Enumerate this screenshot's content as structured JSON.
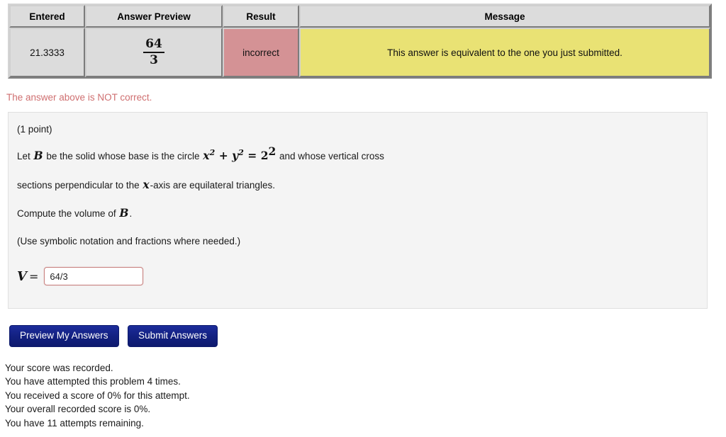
{
  "results_table": {
    "headers": [
      "Entered",
      "Answer Preview",
      "Result",
      "Message"
    ],
    "row": {
      "entered": "21.3333",
      "preview_numerator": "64",
      "preview_denominator": "3",
      "result": "incorrect",
      "message": "This answer is equivalent to the one you just submitted."
    },
    "colors": {
      "header_bg": "#dcdcdc",
      "cell_bg": "#dcdcdc",
      "result_bg": "#d49295",
      "result_text": "#241d8c",
      "message_bg": "#e9e274"
    }
  },
  "notice": {
    "text": "The answer above is NOT correct.",
    "color": "#cf6f70"
  },
  "problem": {
    "points": "(1 point)",
    "line1_a": "Let ",
    "line1_var": "B",
    "line1_b": " be the solid whose base is the circle ",
    "line1_math": {
      "x": "x",
      "x_exp": "2",
      "plus": "+",
      "y": "y",
      "y_exp": "2",
      "equals": "=",
      "two": "2",
      "two_exp": "2"
    },
    "line1_c": " and whose vertical cross",
    "line2_a": "sections perpendicular to the ",
    "line2_var": "x",
    "line2_b": "-axis are equilateral triangles.",
    "line3_a": "Compute the volume of ",
    "line3_var": "B",
    "line3_b": ".",
    "line4": "(Use symbolic notation and fractions where needed.)",
    "answer": {
      "variable": "V",
      "equals": "=",
      "value": "64/3",
      "placeholder": ""
    }
  },
  "buttons": {
    "preview": "Preview My Answers",
    "submit": "Submit Answers",
    "color": "#122080"
  },
  "footer": {
    "lines": [
      "Your score was recorded.",
      "You have attempted this problem 4 times.",
      "You received a score of 0% for this attempt.",
      "Your overall recorded score is 0%.",
      "You have 11 attempts remaining."
    ]
  }
}
